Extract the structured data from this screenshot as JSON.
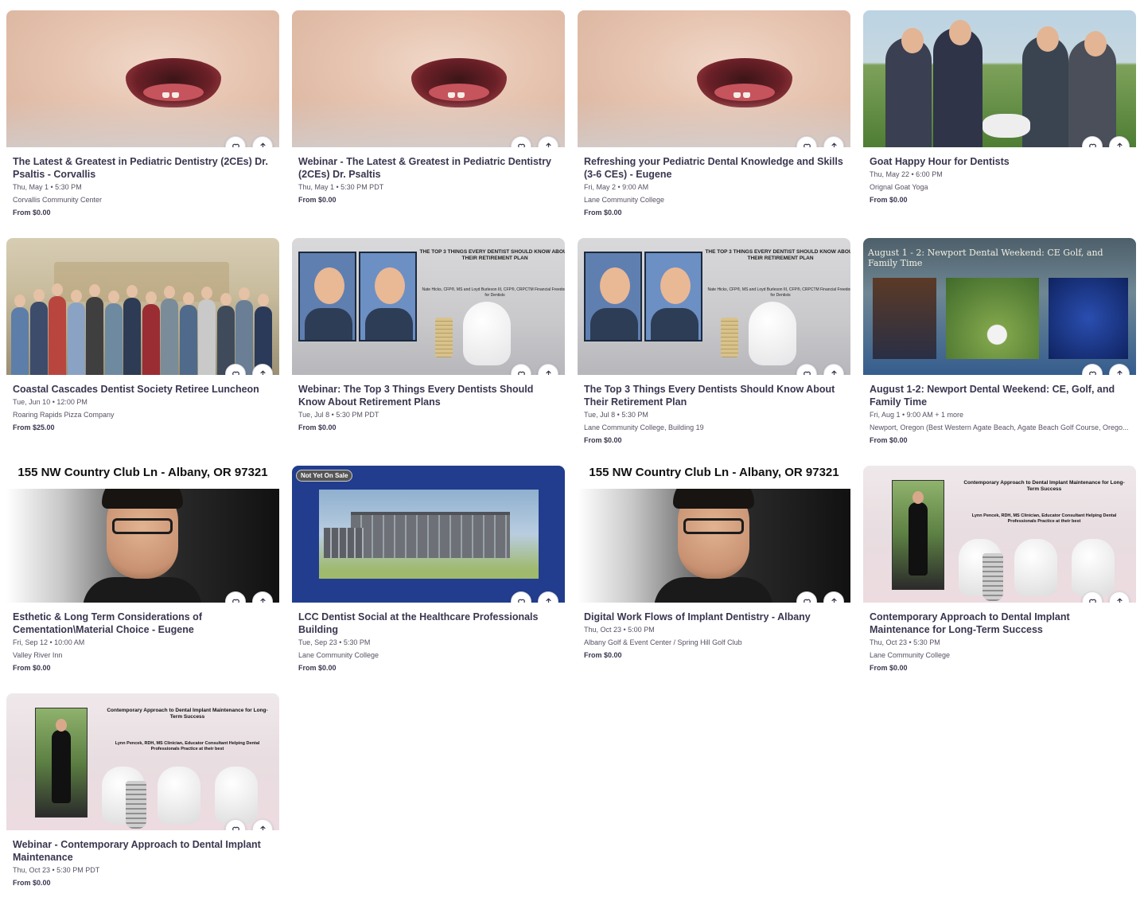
{
  "events": [
    {
      "title": "The Latest & Greatest in Pediatric Dentistry (2CEs) Dr. Psaltis - Corvallis",
      "date": "Thu, May 1 • 5:30 PM",
      "location": "Corvallis Community Center",
      "price": "From $0.00",
      "image": "baby"
    },
    {
      "title": "Webinar - The Latest & Greatest in Pediatric Dentistry (2CEs) Dr. Psaltis",
      "date": "Thu, May 1 • 5:30 PM PDT",
      "location": "",
      "price": "From $0.00",
      "image": "baby"
    },
    {
      "title": "Refreshing your Pediatric Dental Knowledge and Skills (3-6 CEs) - Eugene",
      "date": "Fri, May 2 • 9:00 AM",
      "location": "Lane Community College",
      "price": "From $0.00",
      "image": "baby"
    },
    {
      "title": "Goat Happy Hour for Dentists",
      "date": "Thu, May 22 • 6:00 PM",
      "location": "Orignal Goat Yoga",
      "price": "From $0.00",
      "image": "goat"
    },
    {
      "title": "Coastal Cascades Dentist Society Retiree Luncheon",
      "date": "Tue, Jun 10 • 12:00 PM",
      "location": "Roaring Rapids Pizza Company",
      "price": "From $25.00",
      "image": "group"
    },
    {
      "title": "Webinar: The Top 3 Things Every Dentists Should Know About Retirement Plans",
      "date": "Tue, Jul 8 • 5:30 PM PDT",
      "location": "",
      "price": "From $0.00",
      "image": "retire"
    },
    {
      "title": "The Top 3 Things Every Dentists Should Know About Their Retirement Plan",
      "date": "Tue, Jul 8 • 5:30 PM",
      "location": "Lane Community College, Building 19",
      "price": "From $0.00",
      "image": "retire"
    },
    {
      "title": "August 1-2: Newport Dental Weekend: CE, Golf, and Family Time",
      "date": "Fri, Aug 1 • 9:00 AM + 1 more",
      "location": "Newport, Oregon (Best Western Agate Beach, Agate Beach Golf Course, Orego...",
      "price": "From $0.00",
      "image": "newport"
    },
    {
      "title": "Esthetic & Long Term Considerations of Cementation\\Material Choice - Eugene",
      "date": "Fri, Sep 12 • 10:00 AM",
      "location": "Valley River Inn",
      "price": "From $0.00",
      "image": "chang"
    },
    {
      "title": "LCC Dentist Social at the Healthcare Professionals Building",
      "date": "Tue, Sep 23 • 5:30 PM",
      "location": "Lane Community College",
      "price": "From $0.00",
      "image": "lcc"
    },
    {
      "title": "Digital Work Flows of Implant Dentistry - Albany",
      "date": "Thu, Oct 23 • 5:00 PM",
      "location": "Albany Golf & Event Center / Spring Hill Golf Club",
      "price": "From $0.00",
      "image": "chang"
    },
    {
      "title": "Contemporary Approach to Dental Implant Maintenance for Long-Term Success",
      "date": "Thu, Oct 23 • 5:30 PM",
      "location": "Lane Community College",
      "price": "From $0.00",
      "image": "implant"
    },
    {
      "title": "Webinar - Contemporary Approach to Dental Implant Maintenance",
      "date": "Thu, Oct 23 • 5:30 PM PDT",
      "location": "",
      "price": "From $0.00",
      "image": "implant"
    }
  ],
  "image_text": {
    "retire_headline": "THE TOP 3 THINGS EVERY DENTIST SHOULD KNOW ABOUT THEIR RETIREMENT PLAN",
    "retire_names": "Nate Hicks, CFP®, MS and Loyd Burleson III, CFP®, CRPCTM Financial Freedom for Dentists",
    "newport_banner": "August 1 - 2: Newport Dental Weekend: CE Golf, and Family Time",
    "chang_address": "155 NW Country Club Ln - Albany, OR 97321",
    "lcc_badge": "Not Yet On Sale",
    "implant_title": "Contemporary Approach to Dental Implant Maintenance for Long-Term Success",
    "implant_speaker": "Lynn Pencek, RDH, MS Clinician, Educator Consultant Helping Dental Professionals Practice at their best"
  },
  "icons": {
    "like": "heart-icon",
    "share": "share-icon"
  },
  "colors": {
    "title": "#39364f",
    "meta": "#585163",
    "lcc_bg": "#223d8d"
  }
}
